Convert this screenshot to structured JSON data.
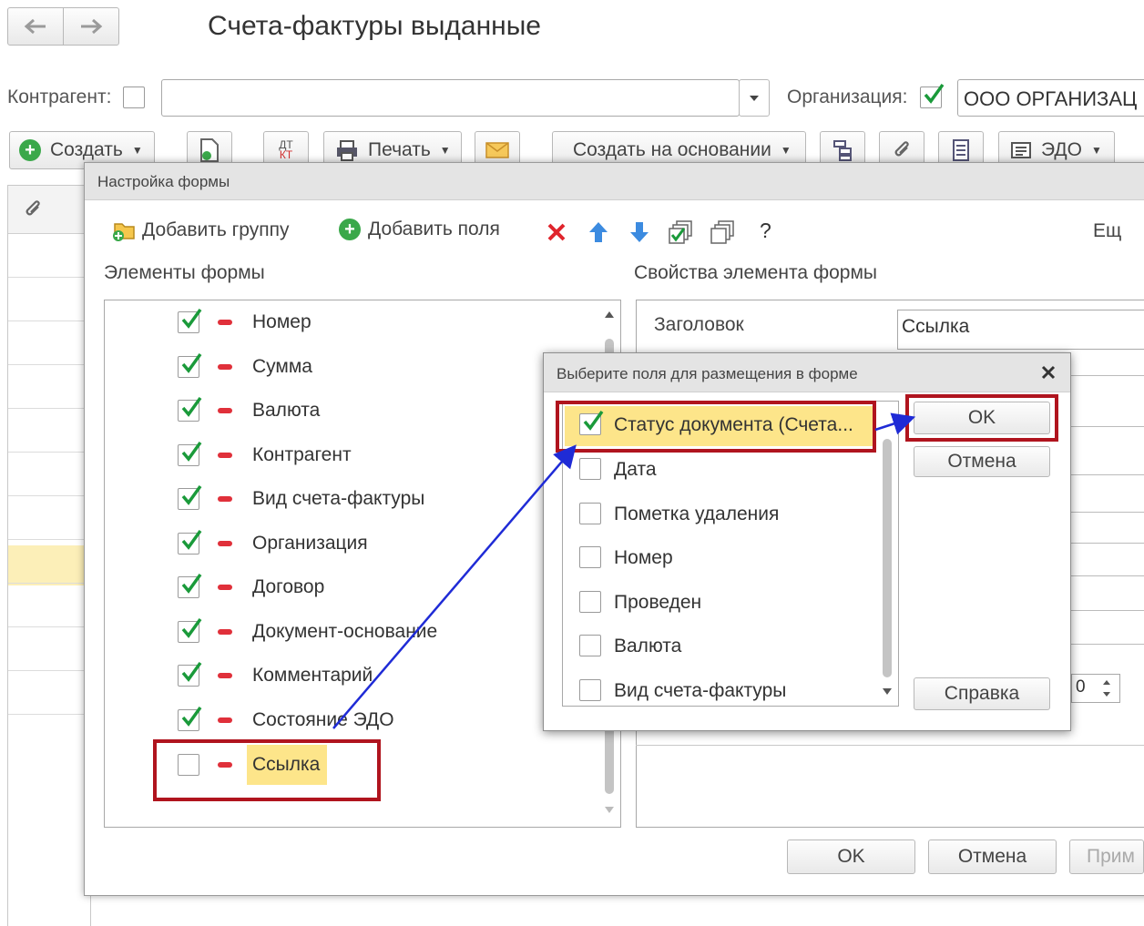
{
  "window": {
    "title": "Счета-фактуры выданные"
  },
  "filter": {
    "counterparty_label": "Контрагент:",
    "counterparty_value": "",
    "organization_label": "Организация:",
    "organization_value": "ООО ОРГАНИЗАЦ"
  },
  "toolbar": {
    "create": "Создать",
    "print": "Печать",
    "create_based_on": "Создать на основании",
    "edo": "ЭДО"
  },
  "settings_dialog": {
    "title": "Настройка формы",
    "add_group": "Добавить группу",
    "add_fields": "Добавить поля",
    "question": "?",
    "more": "Ещ",
    "elements_header": "Элементы формы",
    "properties_header": "Свойства элемента формы",
    "property_title_label": "Заголовок",
    "property_title_value": "Ссылка",
    "elements": [
      {
        "label": "Номер",
        "checked": true
      },
      {
        "label": "Сумма",
        "checked": true
      },
      {
        "label": "Валюта",
        "checked": true
      },
      {
        "label": "Контрагент",
        "checked": true
      },
      {
        "label": "Вид счета-фактуры",
        "checked": true
      },
      {
        "label": "Организация",
        "checked": true
      },
      {
        "label": "Договор",
        "checked": true
      },
      {
        "label": "Документ-основание",
        "checked": true
      },
      {
        "label": "Комментарий",
        "checked": true
      },
      {
        "label": "Состояние ЭДО",
        "checked": true
      },
      {
        "label": "Ссылка",
        "checked": false
      }
    ],
    "spinner_value": "0",
    "ok": "OK",
    "cancel": "Отмена",
    "apply": "Прим"
  },
  "fields_dialog": {
    "title": "Выберите поля для размещения в форме",
    "fields": [
      {
        "label": "Статус документа (Счета...",
        "checked": true
      },
      {
        "label": "Дата",
        "checked": false
      },
      {
        "label": "Пометка удаления",
        "checked": false
      },
      {
        "label": "Номер",
        "checked": false
      },
      {
        "label": "Проведен",
        "checked": false
      },
      {
        "label": "Валюта",
        "checked": false
      },
      {
        "label": "Вид счета-фактуры",
        "checked": false
      }
    ],
    "ok": "OK",
    "cancel": "Отмена",
    "help": "Справка"
  },
  "colors": {
    "highlight_yellow": "#fde58a",
    "annotation_red": "#b0141e",
    "annotation_blue": "#1f2bd6",
    "check_green": "#1a9a3a"
  }
}
